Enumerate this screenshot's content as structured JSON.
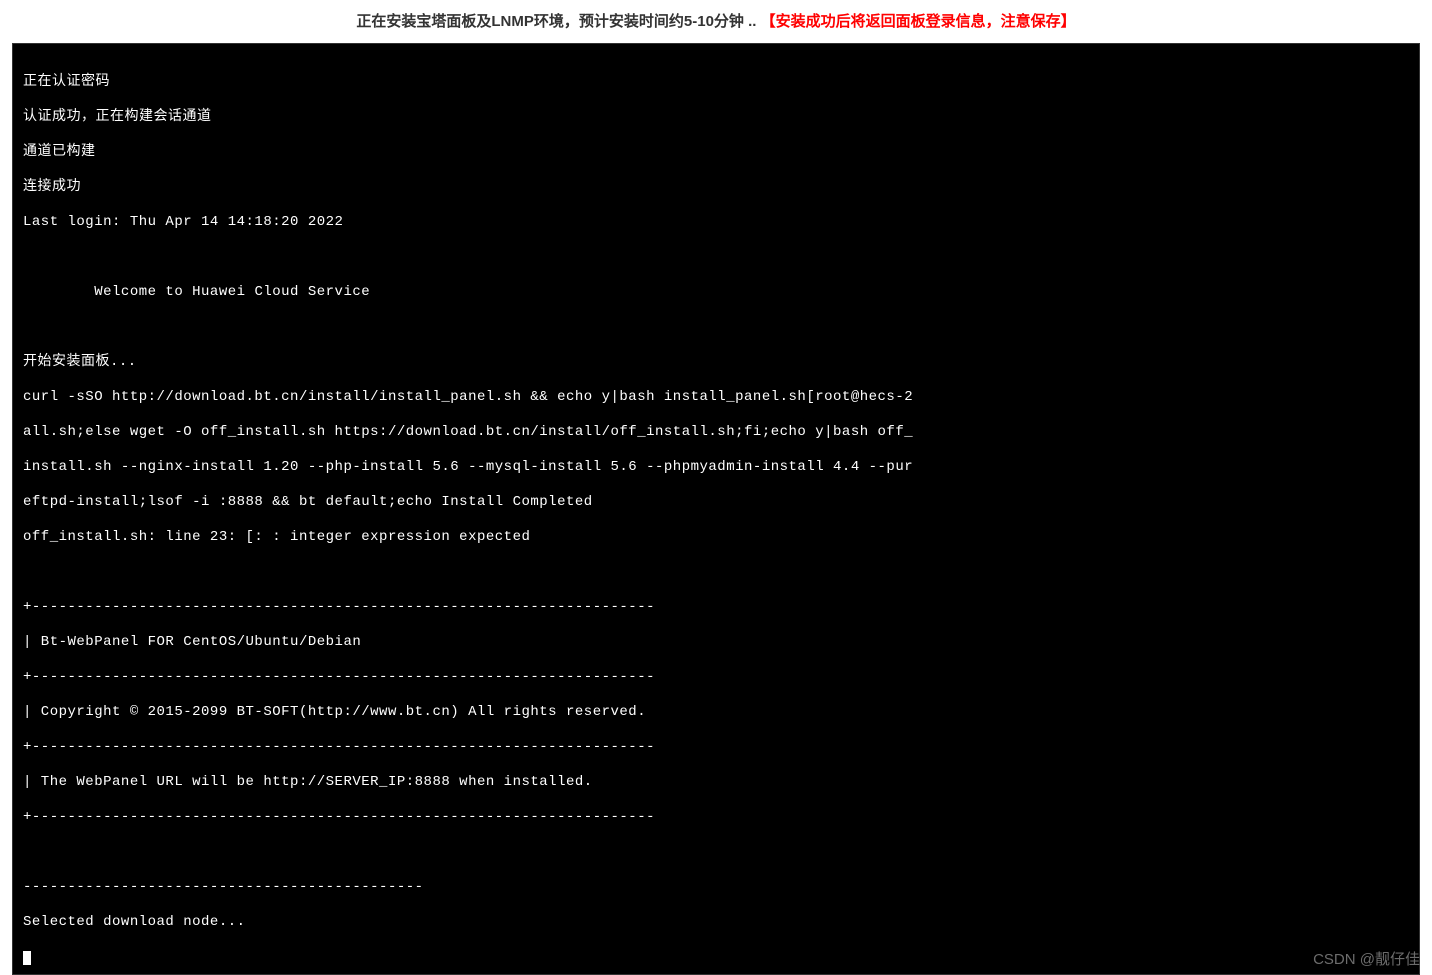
{
  "header": {
    "status_text": "正在安装宝塔面板及LNMP环境，预计安装时间约5-10分钟 ..    ",
    "warning_text": "【安装成功后将返回面板登录信息，注意保存】"
  },
  "terminal": {
    "lines": [
      "正在认证密码",
      "认证成功，正在构建会话通道",
      "通道已构建",
      "连接成功",
      "Last login: Thu Apr 14 14:18:20 2022",
      "",
      "        Welcome to Huawei Cloud Service",
      "",
      "开始安装面板...",
      "curl -sSO http://download.bt.cn/install/install_panel.sh && echo y|bash install_panel.sh[root@hecs-2",
      "all.sh;else wget -O off_install.sh https://download.bt.cn/install/off_install.sh;fi;echo y|bash off_",
      "install.sh --nginx-install 1.20 --php-install 5.6 --mysql-install 5.6 --phpmyadmin-install 4.4 --pur",
      "eftpd-install;lsof -i :8888 && bt default;echo Install Completed",
      "off_install.sh: line 23: [: : integer expression expected",
      "",
      "+----------------------------------------------------------------------",
      "| Bt-WebPanel FOR CentOS/Ubuntu/Debian",
      "+----------------------------------------------------------------------",
      "| Copyright © 2015-2099 BT-SOFT(http://www.bt.cn) All rights reserved.",
      "+----------------------------------------------------------------------",
      "| The WebPanel URL will be http://SERVER_IP:8888 when installed.",
      "+----------------------------------------------------------------------",
      "",
      "---------------------------------------------",
      "Selected download node..."
    ]
  },
  "watermark": {
    "text": "CSDN @靓仔佳"
  }
}
